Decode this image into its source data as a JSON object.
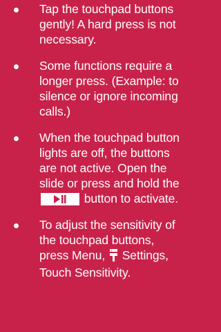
{
  "tips": [
    {
      "text": "Tap the touchpad buttons gently! A hard press is not necessary."
    },
    {
      "text": "Some functions require a longer press. (Example: to silence or ignore incoming calls.)"
    },
    {
      "text_before": "When the touchpad button lights are off, the buttons are not active. Open the slide or press and hold the",
      "text_after": "button to activate.",
      "icon": "play-pause-icon"
    },
    {
      "text_before": "To adjust the sensitivity of the touchpad buttons, press Menu,",
      "text_after": "Settings, Touch Sensitivity.",
      "icon": "menu-key-icon"
    }
  ],
  "colors": {
    "background": "#c8224a",
    "text": "#ffffff",
    "icon_glyph": "#c8224a"
  }
}
